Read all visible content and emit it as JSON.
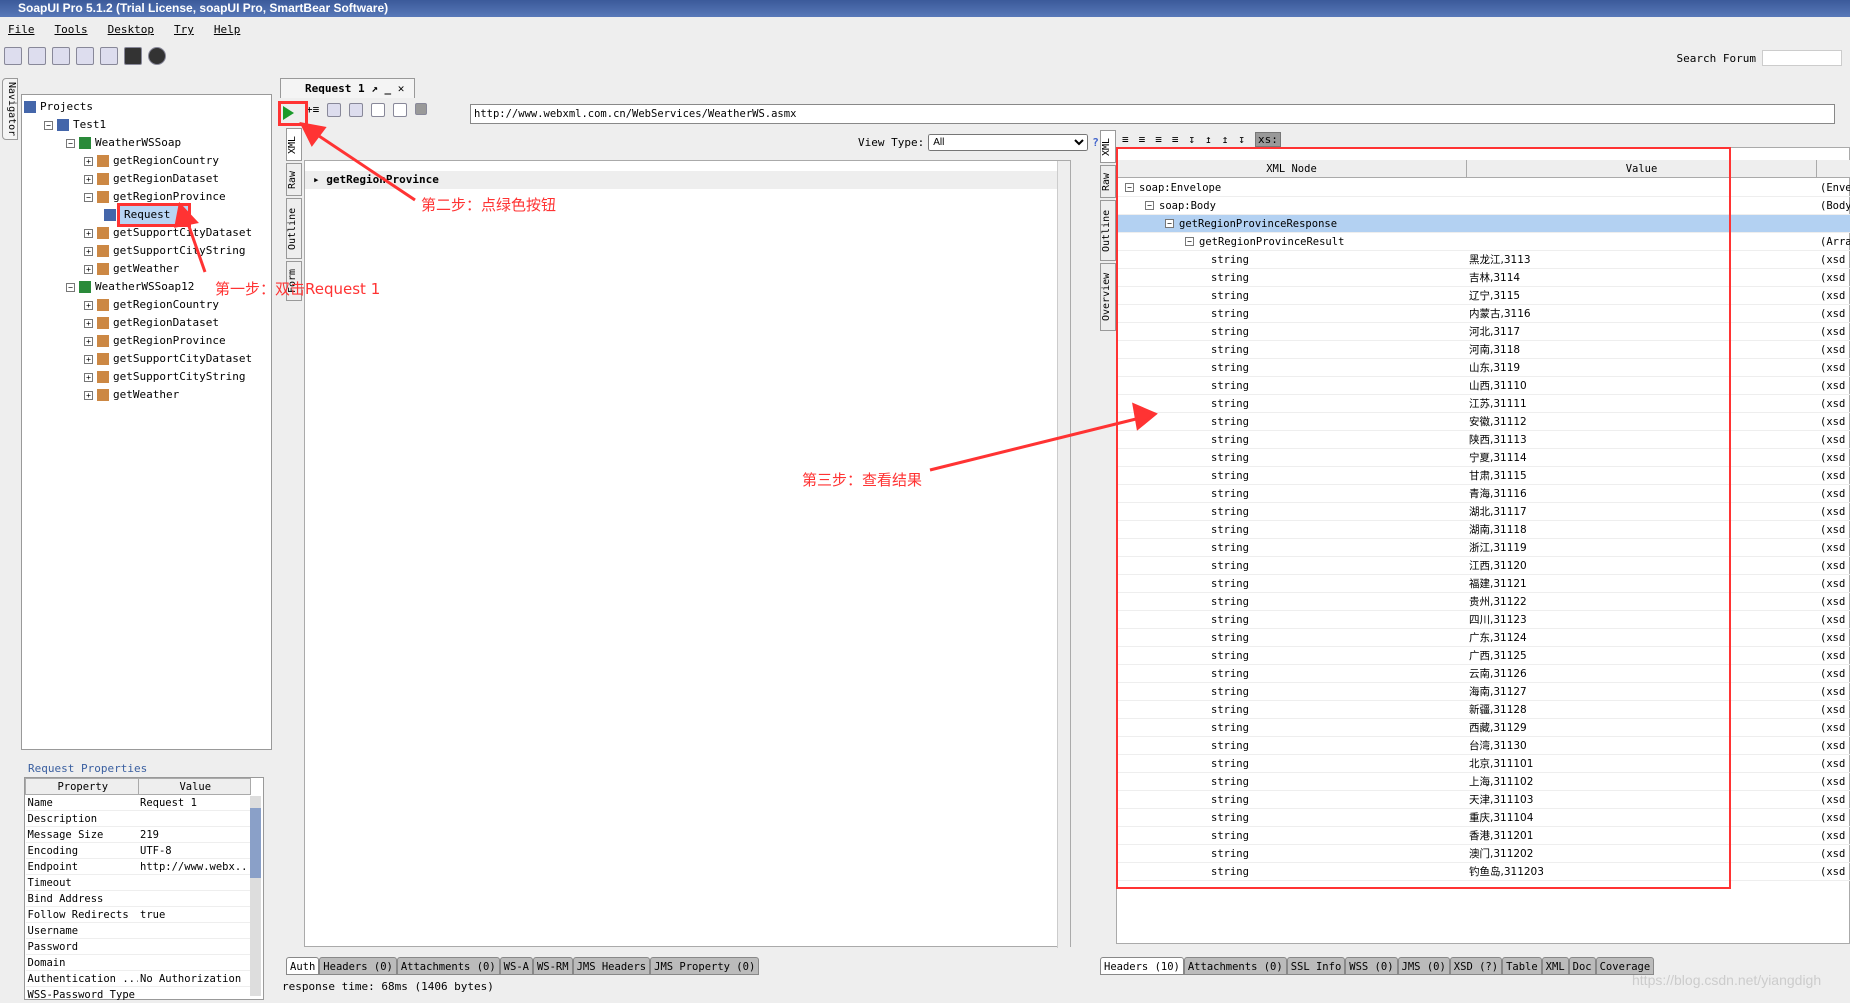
{
  "window": {
    "title": "SoapUI Pro 5.1.2 (Trial License, soapUI Pro, SmartBear Software)"
  },
  "menu": [
    "File",
    "Tools",
    "Desktop",
    "Try",
    "Help"
  ],
  "toolbar": {
    "search_label": "Search Forum"
  },
  "navigator": {
    "tab_label": "Navigator",
    "tree": [
      {
        "label": "Projects",
        "level": 0
      },
      {
        "label": "Test1",
        "level": 1
      },
      {
        "label": "WeatherWSSoap",
        "level": 2
      },
      {
        "label": "getRegionCountry",
        "level": 3
      },
      {
        "label": "getRegionDataset",
        "level": 3
      },
      {
        "label": "getRegionProvince",
        "level": 3
      },
      {
        "label": "Request 1",
        "level": 4,
        "selected": true
      },
      {
        "label": "getSupportCityDataset",
        "level": 3
      },
      {
        "label": "getSupportCityString",
        "level": 3
      },
      {
        "label": "getWeather",
        "level": 3
      },
      {
        "label": "WeatherWSSoap12",
        "level": 2
      },
      {
        "label": "getRegionCountry",
        "level": 3
      },
      {
        "label": "getRegionDataset",
        "level": 3
      },
      {
        "label": "getRegionProvince",
        "level": 3
      },
      {
        "label": "getSupportCityDataset",
        "level": 3
      },
      {
        "label": "getSupportCityString",
        "level": 3
      },
      {
        "label": "getWeather",
        "level": 3
      }
    ]
  },
  "properties": {
    "title": "Request Properties",
    "headers": [
      "Property",
      "Value"
    ],
    "rows": [
      [
        "Name",
        "Request 1"
      ],
      [
        "Description",
        ""
      ],
      [
        "Message Size",
        "219"
      ],
      [
        "Encoding",
        "UTF-8"
      ],
      [
        "Endpoint",
        "http://www.webx..."
      ],
      [
        "Timeout",
        ""
      ],
      [
        "Bind Address",
        ""
      ],
      [
        "Follow Redirects",
        "true"
      ],
      [
        "Username",
        ""
      ],
      [
        "Password",
        ""
      ],
      [
        "Domain",
        ""
      ],
      [
        "Authentication ...",
        "No Authorization"
      ],
      [
        "WSS-Password Type",
        ""
      ]
    ]
  },
  "editor": {
    "tab_title": "Request 1",
    "url": "http://www.webxml.com.cn/WebServices/WeatherWS.asmx",
    "request_tabs": [
      "XML",
      "Raw",
      "Outline",
      "Form"
    ],
    "request_root": "getRegionProvince",
    "view_type_label": "View Type:",
    "view_type_value": "All",
    "response_tabs": [
      "XML",
      "Raw",
      "Outline",
      "Overview"
    ],
    "columns": [
      "XML Node",
      "Value"
    ],
    "nodes": [
      {
        "name": "soap:Envelope",
        "value": "",
        "type": "(Enve",
        "level": 0
      },
      {
        "name": "soap:Body",
        "value": "",
        "type": "(Body",
        "level": 1
      },
      {
        "name": "getRegionProvinceResponse",
        "value": "",
        "type": "",
        "level": 2,
        "selected": true
      },
      {
        "name": "getRegionProvinceResult",
        "value": "",
        "type": "(Arra",
        "level": 3
      }
    ],
    "strings": [
      "黑龙江,3113",
      "吉林,3114",
      "辽宁,3115",
      "内蒙古,3116",
      "河北,3117",
      "河南,3118",
      "山东,3119",
      "山西,31110",
      "江苏,31111",
      "安徽,31112",
      "陕西,31113",
      "宁夏,31114",
      "甘肃,31115",
      "青海,31116",
      "湖北,31117",
      "湖南,31118",
      "浙江,31119",
      "江西,31120",
      "福建,31121",
      "贵州,31122",
      "四川,31123",
      "广东,31124",
      "广西,31125",
      "云南,31126",
      "海南,31127",
      "新疆,31128",
      "西藏,31129",
      "台湾,31130",
      "北京,311101",
      "上海,311102",
      "天津,311103",
      "重庆,311104",
      "香港,311201",
      "澳门,311202",
      "钓鱼岛,311203"
    ],
    "string_label": "string",
    "string_type": "(xsd",
    "request_bottom_tabs": [
      "Auth",
      "Headers (0)",
      "Attachments (0)",
      "WS-A",
      "WS-RM",
      "JMS Headers",
      "JMS Property (0)"
    ],
    "response_bottom_tabs": [
      "Headers (10)",
      "Attachments (0)",
      "SSL Info",
      "WSS (0)",
      "JMS (0)",
      "XSD (?)",
      "Table",
      "XML",
      "Doc",
      "Coverage"
    ],
    "status": "response time: 68ms (1406 bytes)"
  },
  "annotations": {
    "step1": "第一步：双击Request 1",
    "step2": "第二步：点绿色按钮",
    "step3": "第三步：查看结果",
    "accent": "#ff3333"
  },
  "watermark": "https://blog.csdn.net/yiangdigh"
}
